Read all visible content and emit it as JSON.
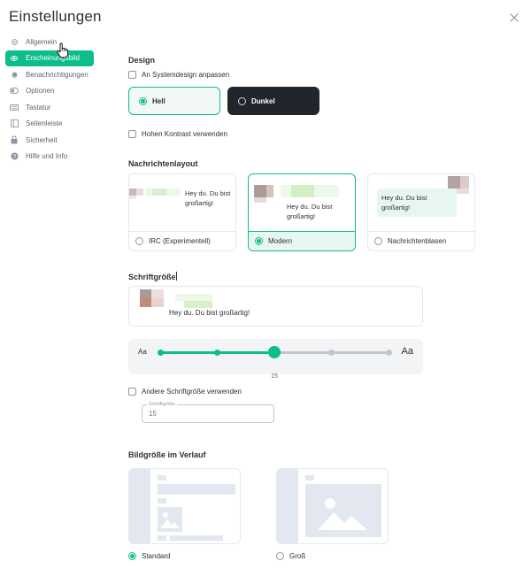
{
  "dialog": {
    "title": "Einstellungen"
  },
  "sidebar": {
    "items": [
      {
        "label": "Allgemein",
        "icon": "gear-icon"
      },
      {
        "label": "Erscheinungsbild",
        "icon": "eye-icon"
      },
      {
        "label": "Benachrichtigungen",
        "icon": "bell-icon"
      },
      {
        "label": "Optionen",
        "icon": "toggle-icon"
      },
      {
        "label": "Tastatur",
        "icon": "keyboard-icon"
      },
      {
        "label": "Seitenleiste",
        "icon": "sidebar-icon"
      },
      {
        "label": "Sicherheit",
        "icon": "lock-icon"
      },
      {
        "label": "Hilfe und Info",
        "icon": "help-icon"
      }
    ],
    "active_index": 1
  },
  "design": {
    "heading": "Design",
    "system_checkbox": "An Systemdesign anpassen",
    "light_label": "Hell",
    "dark_label": "Dunkel",
    "high_contrast": "Hohen Kontrast verwenden"
  },
  "layout": {
    "heading": "Nachrichtenlayout",
    "sample_text": "Hey du. Du bist großartig!",
    "irc_label": "IRC (Experimentell)",
    "modern_label": "Modern",
    "bubble_label": "Nachrichtenblasen",
    "irc_text": "Hey du. Du bist großartig!",
    "modern_text": "Hey du. Du bist großartig!",
    "bubble_text": "Hey du. Du bist großartig!"
  },
  "font": {
    "heading": "Schriftgröße",
    "preview_text": "Hey du. Du bist großartig!",
    "aa_small": "Aa",
    "aa_big": "Aa",
    "slider_value": "15",
    "slider_position": 0.5,
    "custom_checkbox": "Andere Schriftgröße verwenden",
    "field_label": "Schriftgröße",
    "field_placeholder": "15"
  },
  "image_size": {
    "heading": "Bildgröße im Verlauf",
    "standard_label": "Standard",
    "large_label": "Groß"
  },
  "colors": {
    "accent": "#0dbd8b",
    "dark": "#21262c",
    "border": "#e3e8f0"
  }
}
